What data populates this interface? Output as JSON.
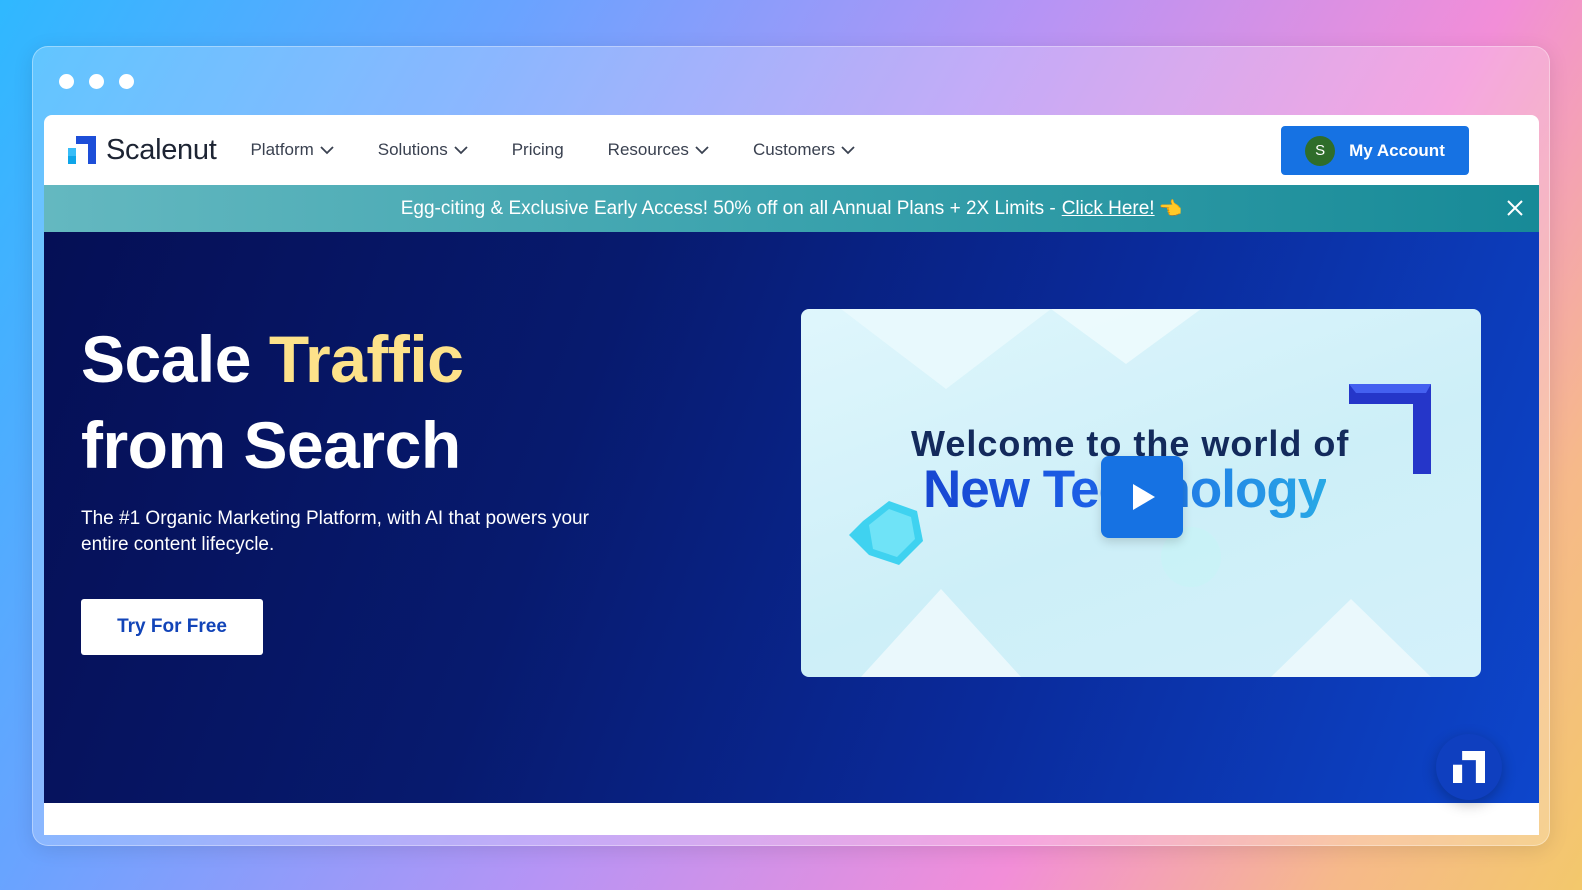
{
  "browser": {
    "window_dots": 3
  },
  "nav": {
    "logo_text": "Scalenut",
    "items": [
      {
        "label": "Platform",
        "dropdown": true
      },
      {
        "label": "Solutions",
        "dropdown": true
      },
      {
        "label": "Pricing",
        "dropdown": false
      },
      {
        "label": "Resources",
        "dropdown": true
      },
      {
        "label": "Customers",
        "dropdown": true
      }
    ],
    "account": {
      "avatar_initial": "S",
      "label": "My Account"
    }
  },
  "banner": {
    "text": "Egg-citing & Exclusive Early Access! 50% off on all Annual Plans + 2X Limits - ",
    "link": "Click Here!",
    "emoji": "👈"
  },
  "hero": {
    "title_part1": "Scale ",
    "title_accent": "Traffic",
    "title_line2": "from Search",
    "subtitle": "The #1 Organic Marketing Platform, with AI that powers your entire content lifecycle.",
    "cta": "Try For Free"
  },
  "video": {
    "line1": "Welcome to the world of",
    "line2": "New Technology"
  },
  "colors": {
    "brand_blue": "#1672e3",
    "hero_dark": "#050f55",
    "accent_yellow": "#fde28a",
    "banner_teal": "#3aa2ad"
  }
}
